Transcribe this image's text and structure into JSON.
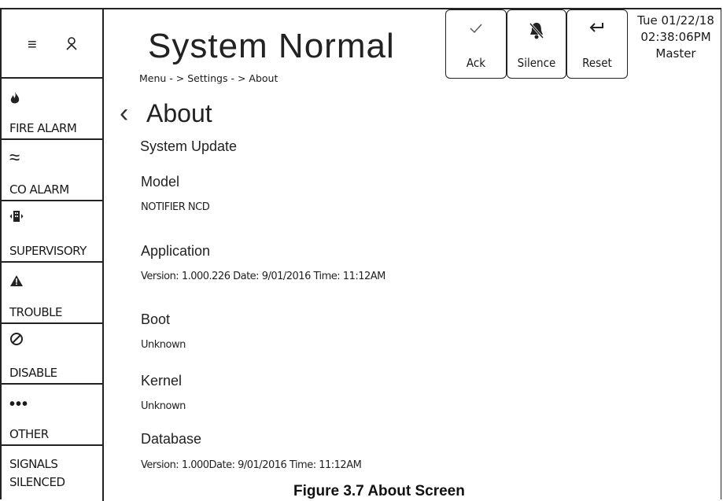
{
  "header": {
    "status_title": "System Normal",
    "buttons": {
      "ack": {
        "label": "Ack",
        "icon": "check-icon"
      },
      "silence": {
        "label": "Silence",
        "icon": "bell-slash-icon"
      },
      "reset": {
        "label": "Reset",
        "icon": "return-arrow-icon"
      }
    },
    "datetime": {
      "date": "Tue 01/22/18",
      "time": "02:38:06PM",
      "mode": "Master"
    }
  },
  "sidebar": {
    "items": [
      {
        "label": "FIRE ALARM",
        "icon": "flame-icon"
      },
      {
        "label": "CO ALARM",
        "icon": "waves-icon"
      },
      {
        "label": "SUPERVISORY",
        "icon": "building-icon"
      },
      {
        "label": "TROUBLE",
        "icon": "warning-icon"
      },
      {
        "label": "DISABLE",
        "icon": "disable-icon"
      },
      {
        "label": "OTHER",
        "icon": "dots-icon"
      }
    ],
    "signals_line1": "SIGNALS",
    "signals_line2": "SILENCED"
  },
  "main": {
    "breadcrumb": "Menu - > Settings - > About",
    "title": "About",
    "system_update": "System Update",
    "fields": [
      {
        "label": "Model",
        "value": "NOTIFIER NCD"
      },
      {
        "label": "Application",
        "value": "Version: 1.000.226 Date: 9/01/2016 Time: 11:12AM"
      },
      {
        "label": "Boot",
        "value": "Unknown"
      },
      {
        "label": "Kernel",
        "value": "Unknown"
      },
      {
        "label": "Database",
        "value": "Version: 1.000Date: 9/01/2016 Time: 11:12AM"
      }
    ]
  },
  "caption": "Figure 3.7  About Screen"
}
